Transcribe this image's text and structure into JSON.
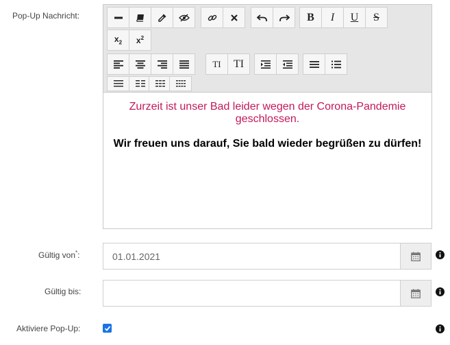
{
  "labels": {
    "popup_message": "Pop-Up Nachricht:",
    "valid_from": "Gültig von",
    "valid_from_required": "*",
    "valid_from_colon": ":",
    "valid_until": "Gültig bis:",
    "activate_popup": "Aktiviere Pop-Up:"
  },
  "toolbar": {
    "subscript_label": "x",
    "subscript_mark": "2",
    "superscript_label": "x",
    "superscript_mark": "2",
    "bold_label": "B",
    "italic_label": "I",
    "underline_label": "U",
    "strike_label": "S",
    "fontsize_small_label": "TI",
    "fontsize_large_label": "TI"
  },
  "editor": {
    "line1": "Zurzeit ist unser Bad leider wegen der Corona-Pandemie geschlossen.",
    "line2": "Wir freuen uns darauf, Sie bald wieder begrüßen zu dürfen!",
    "line1_color": "#c2185b"
  },
  "valid_from": {
    "value": "01.01.2021",
    "placeholder": ""
  },
  "valid_until": {
    "value": "",
    "placeholder": ""
  },
  "activate_popup": {
    "checked": true,
    "color": "#1a73e8"
  },
  "icons": {
    "calendar": "calendar-icon",
    "info": "info-icon"
  }
}
